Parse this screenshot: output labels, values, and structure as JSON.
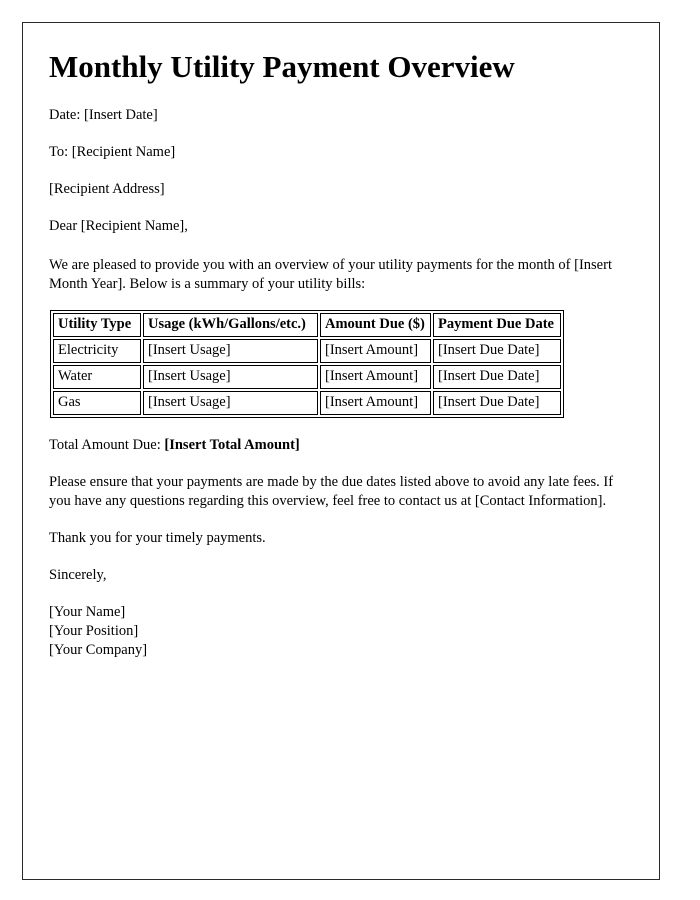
{
  "document": {
    "title": "Monthly Utility Payment Overview",
    "date_line": "Date: [Insert Date]",
    "to_line": "To: [Recipient Name]",
    "address_line": "[Recipient Address]",
    "salutation": "Dear [Recipient Name],",
    "intro_paragraph": "We are pleased to provide you with an overview of your utility payments for the month of [Insert Month Year]. Below is a summary of your utility bills:",
    "total_label": "Total Amount Due:",
    "total_value": "[Insert Total Amount]",
    "closing_paragraph": "Please ensure that your payments are made by the due dates listed above to avoid any late fees. If you have any questions regarding this overview, feel free to contact us at [Contact Information].",
    "thanks_paragraph": "Thank you for your timely payments.",
    "sincerely": "Sincerely,",
    "signature": {
      "name": "[Your Name]",
      "position": "[Your Position]",
      "company": "[Your Company]"
    }
  },
  "table": {
    "headers": [
      "Utility Type",
      "Usage (kWh/Gallons/etc.)",
      "Amount Due ($)",
      "Payment Due Date"
    ],
    "rows": [
      {
        "utility": "Electricity",
        "usage": "[Insert Usage]",
        "amount": "[Insert Amount]",
        "due": "[Insert Due Date]"
      },
      {
        "utility": "Water",
        "usage": "[Insert Usage]",
        "amount": "[Insert Amount]",
        "due": "[Insert Due Date]"
      },
      {
        "utility": "Gas",
        "usage": "[Insert Usage]",
        "amount": "[Insert Amount]",
        "due": "[Insert Due Date]"
      }
    ]
  },
  "colors": {
    "text": "#000000",
    "page_border": "#2a2a2a",
    "table_border": "#000000",
    "background": "#ffffff"
  }
}
